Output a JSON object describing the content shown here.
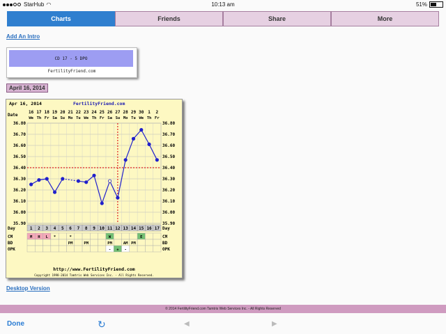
{
  "status": {
    "carrier": "StarHub",
    "time": "10:13 am",
    "battery": "51%"
  },
  "tabs": [
    {
      "label": "Charts"
    },
    {
      "label": "Friends"
    },
    {
      "label": "Share"
    },
    {
      "label": "More"
    }
  ],
  "links": {
    "intro": "Add An Intro",
    "desktop": "Desktop Version"
  },
  "ticker": {
    "text": "CD 17 - 5 DPO",
    "brand": "FertilityFriend.com"
  },
  "date_label": "April 16, 2014",
  "footer": "© 2014 FertilityFriend.com Tamtris Web Services Inc. - All Rights Reserved",
  "toolbar": {
    "done": "Done"
  },
  "chart_data": {
    "type": "line",
    "header_date": "Apr 16, 2014",
    "brand": "FertilityFriend.com",
    "url": "http://www.FertilityFriend.com",
    "copyright": "Copyright 1998-2014 Tamtris Web Services Inc. - All Rights Reserved.",
    "row_label_date": "Date",
    "dates": [
      "16",
      "17",
      "18",
      "19",
      "20",
      "21",
      "22",
      "23",
      "24",
      "25",
      "26",
      "27",
      "28",
      "29",
      "30",
      "1",
      "2"
    ],
    "weekdays": [
      "We",
      "Th",
      "Fr",
      "Sa",
      "Su",
      "Mo",
      "Tu",
      "We",
      "Th",
      "Fr",
      "Sa",
      "Su",
      "Mo",
      "Tu",
      "We",
      "Th",
      "Fr"
    ],
    "day_label": "Day",
    "days": [
      "1",
      "2",
      "3",
      "4",
      "5",
      "6",
      "7",
      "8",
      "9",
      "10",
      "11",
      "12",
      "13",
      "14",
      "15",
      "16",
      "17"
    ],
    "y_ticks": [
      "36.80",
      "36.70",
      "36.60",
      "36.50",
      "36.40",
      "36.30",
      "36.20",
      "36.10",
      "36.00",
      "35.90"
    ],
    "ylim": [
      35.9,
      36.8
    ],
    "temps": [
      36.25,
      36.29,
      36.3,
      36.18,
      36.3,
      null,
      36.28,
      36.27,
      36.33,
      36.08,
      36.28,
      36.13,
      36.47,
      36.66,
      36.74,
      36.61,
      36.47
    ],
    "open_points": [
      5,
      10
    ],
    "coverline": 36.4,
    "ovulation_day": 12,
    "rows": [
      {
        "label": "CM",
        "cells": [
          "M",
          "H",
          "L",
          "*",
          "",
          "*",
          "",
          "",
          "",
          "",
          "W",
          "",
          "",
          "",
          "E",
          "",
          ""
        ]
      },
      {
        "label": "BD",
        "cells": [
          "",
          "",
          "",
          "",
          "",
          "PM",
          "",
          "PM",
          "",
          "",
          "PM",
          "",
          "AM",
          "PM",
          "",
          "",
          ""
        ]
      },
      {
        "label": "OPK",
        "cells": [
          "",
          "",
          "",
          "",
          "",
          "",
          "",
          "",
          "",
          "",
          "-",
          "+",
          "-",
          "",
          "",
          "",
          ""
        ]
      }
    ],
    "cm_colors": {
      "M": "#f4a8b8",
      "H": "#f4a8b8",
      "L": "#f4a8b8",
      "W": "#74c074",
      "E": "#74c074"
    },
    "opk_colors": {
      "+": "#74c074",
      "-": "#ffffff"
    }
  }
}
